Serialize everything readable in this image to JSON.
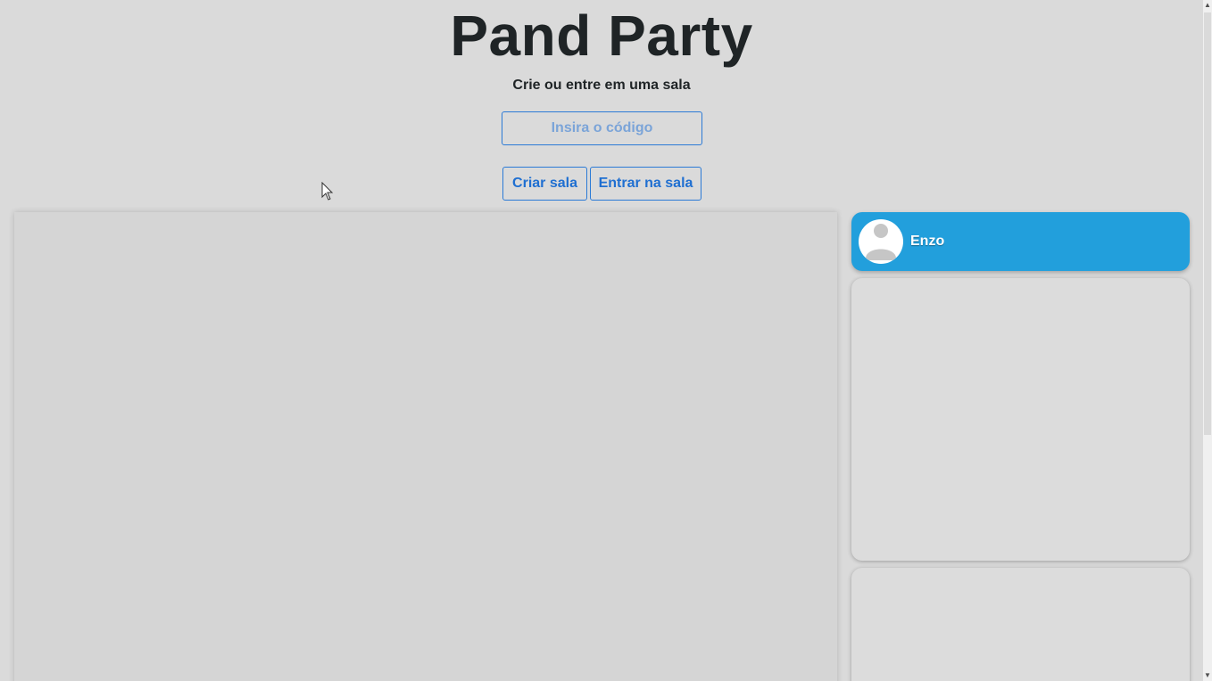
{
  "header": {
    "title": "Pand Party",
    "subtitle": "Crie ou entre em uma sala"
  },
  "room_form": {
    "code_placeholder": "Insira o código",
    "code_value": "",
    "create_label": "Criar sala",
    "join_label": "Entrar na sala"
  },
  "sidebar": {
    "user": {
      "name": "Enzo",
      "avatar_icon": "user-avatar-icon"
    }
  },
  "scrollbar": {
    "up_glyph": "▲",
    "down_glyph": "▼"
  },
  "colors": {
    "background": "#dadada",
    "accent": "#2b7ad6",
    "user_card": "#229fdc",
    "panel": "#dcdcdc"
  }
}
